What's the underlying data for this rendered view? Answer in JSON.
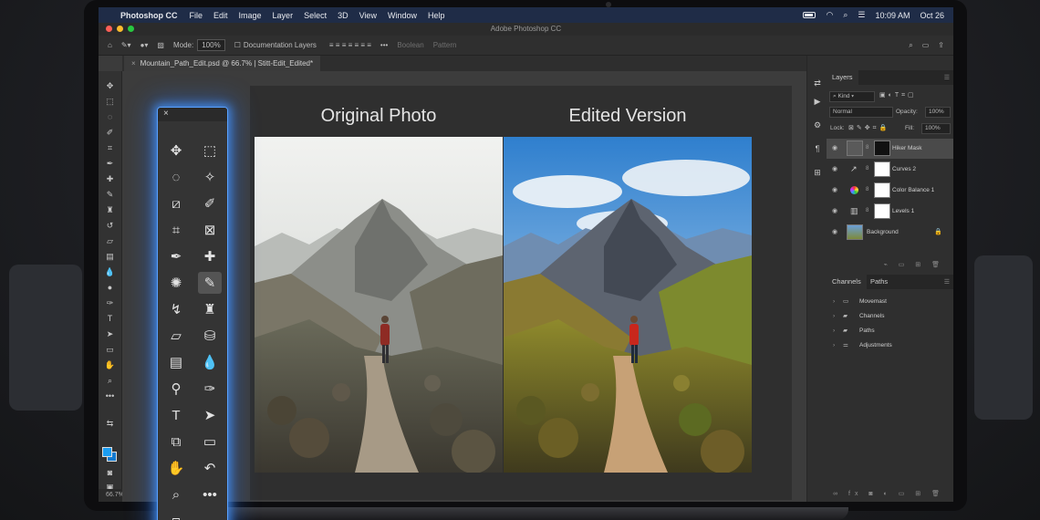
{
  "menubar": {
    "app_name": "Photoshop CC",
    "items": [
      "File",
      "Edit",
      "Image",
      "Layer",
      "Select",
      "3D",
      "View",
      "Window",
      "Help"
    ],
    "time": "10:09 AM",
    "date": "Oct 26"
  },
  "window": {
    "title": "Adobe Photoshop CC"
  },
  "options_bar": {
    "mode_label": "Mode:",
    "mode_value": "100%",
    "doc_layers_label": "Documentation Layers",
    "btn1": "Boolean",
    "btn2": "Pattern"
  },
  "document": {
    "tab_title": "Mountain_Path_Edit.psd @ 66.7% | Stitt-Edit_Edited*",
    "zoom": "66.7%"
  },
  "canvas": {
    "left_caption": "Original Photo",
    "right_caption": "Edited Version"
  },
  "layers_panel": {
    "tab": "Layers",
    "filter_label": "Kind",
    "blend_mode": "Normal",
    "opacity_label": "Opacity:",
    "opacity_value": "100%",
    "lock_label": "Lock:",
    "fill_label": "Fill:",
    "fill_value": "100%",
    "layers": [
      {
        "name": "Hiker Mask"
      },
      {
        "name": "Curves 2"
      },
      {
        "name": "Color Balance 1"
      },
      {
        "name": "Levels 1"
      },
      {
        "name": "Background"
      }
    ]
  },
  "channels_panel": {
    "tabs": [
      "Channels",
      "Paths"
    ],
    "items": [
      {
        "name": "Movemast"
      },
      {
        "name": "Channels"
      },
      {
        "name": "Paths"
      },
      {
        "name": "Adjustments"
      }
    ]
  },
  "colors": {
    "accent_glow": "#4a9dff",
    "foreground": "#1b9df2",
    "background_swatch": "#127ad0",
    "menubar": "#1f2c47"
  }
}
